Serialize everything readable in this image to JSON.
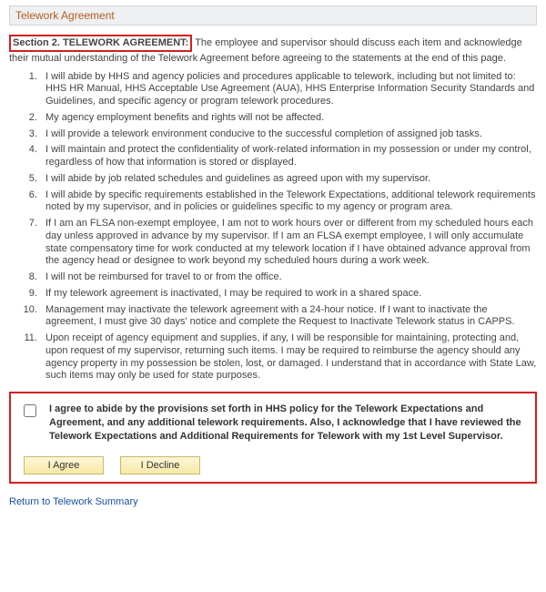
{
  "panel": {
    "title": "Telework Agreement"
  },
  "section": {
    "title_label": "Section 2. TELEWORK AGREEMENT:",
    "intro": "The employee and supervisor should discuss each item and acknowledge their mutual understanding of the Telework Agreement before agreeing to the statements at the end of this page."
  },
  "items": [
    "I will abide by HHS and agency policies and procedures applicable to telework, including but not limited to: HHS HR Manual, HHS Acceptable Use Agreement (AUA), HHS Enterprise Information Security Standards and Guidelines, and specific agency or program telework procedures.",
    "My agency employment benefits and rights will not be affected.",
    "I will provide a telework environment conducive to the successful completion of assigned job tasks.",
    "I will maintain and protect the confidentiality of work-related information in my possession or under my control, regardless of how that information is stored or displayed.",
    "I will abide by job related schedules and guidelines as agreed upon with my supervisor.",
    "I will abide by specific requirements established in the Telework Expectations, additional telework requirements noted by my supervisor, and in policies or guidelines specific to my agency or program area.",
    "If I am an FLSA non-exempt employee, I am not to work hours over or different from my scheduled hours each day unless approved in advance by my supervisor. If I am an FLSA exempt employee, I will only accumulate state compensatory time for work conducted at my telework location if I have obtained advance approval from the agency head or designee to work beyond my scheduled hours during a work week.",
    "I will not be reimbursed for travel to or from the office.",
    "If my telework agreement is inactivated, I may be required to work in a shared space.",
    "Management may inactivate the telework agreement with a 24-hour notice. If I want to inactivate the agreement, I must give 30 days' notice and complete the Request to Inactivate Telework status in CAPPS.",
    "Upon receipt of agency equipment and supplies, if any, I will be responsible for maintaining, protecting and, upon request of my supervisor, returning such items. I may be required to reimburse the agency should any agency property in my possession be stolen, lost, or damaged. I understand that in accordance with State Law, such items may only be used for state purposes."
  ],
  "ack": {
    "text": "I agree to abide by the provisions set forth in HHS policy for the Telework Expectations and Agreement, and any additional telework requirements. Also, I acknowledge that I have reviewed the Telework Expectations and Additional Requirements for Telework with my 1st Level Supervisor."
  },
  "buttons": {
    "agree": "I Agree",
    "decline": "I Decline"
  },
  "links": {
    "return": "Return to Telework Summary"
  }
}
